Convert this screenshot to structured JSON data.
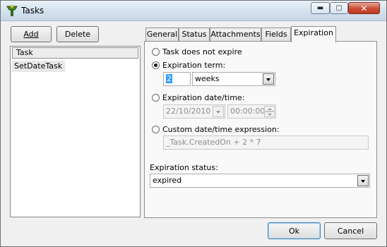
{
  "window": {
    "title": "Tasks",
    "close_symbol": "✕",
    "minimize_symbol": "▬",
    "maximize_symbol": "▢"
  },
  "toolbar": {
    "add_label": "Add",
    "delete_label": "Delete"
  },
  "task_list": {
    "header": "Task",
    "items": [
      "SetDateTask"
    ]
  },
  "tabs": [
    "General",
    "Status",
    "Attachments",
    "Fields",
    "Expiration"
  ],
  "active_tab": "Expiration",
  "expiration": {
    "no_expire_label": "Task does not expire",
    "term_label": "Expiration term:",
    "term_value": "2",
    "term_unit": "weeks",
    "datetime_label": "Expiration date/time:",
    "date_value": "22/10/2010",
    "time_value": "00:00:00",
    "custom_label": "Custom date/time expression:",
    "custom_value": "_Task.CreatedOn + 2 * 7",
    "selected_option": "Expiration term:",
    "status_label": "Expiration status:",
    "status_value": "expired"
  },
  "dialog": {
    "ok_label": "Ok",
    "cancel_label": "Cancel"
  },
  "icons": {
    "app": "tasks-app-icon"
  },
  "colors": {
    "selection": "#3399ff",
    "titlebar": "#d3e0ee",
    "close_button": "#c94b36"
  }
}
